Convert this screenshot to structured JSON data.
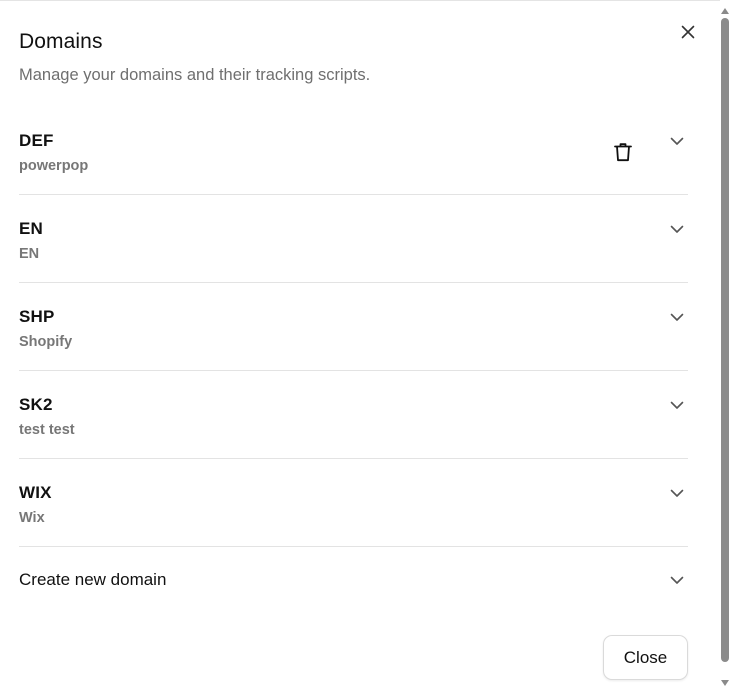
{
  "dialog": {
    "title": "Domains",
    "subtitle": "Manage your domains and their tracking scripts."
  },
  "domains": [
    {
      "code": "DEF",
      "name": "powerpop"
    },
    {
      "code": "EN",
      "name": "EN"
    },
    {
      "code": "SHP",
      "name": "Shopify"
    },
    {
      "code": "SK2",
      "name": "test test"
    },
    {
      "code": "WIX",
      "name": "Wix"
    }
  ],
  "create": {
    "label": "Create new domain"
  },
  "footer": {
    "close_label": "Close"
  },
  "icons": {
    "close": "close-icon",
    "delete": "trash-icon",
    "expand": "chevron-down-icon"
  },
  "colors": {
    "text": "#111111",
    "muted": "#777777",
    "divider": "#e3e3e3"
  }
}
